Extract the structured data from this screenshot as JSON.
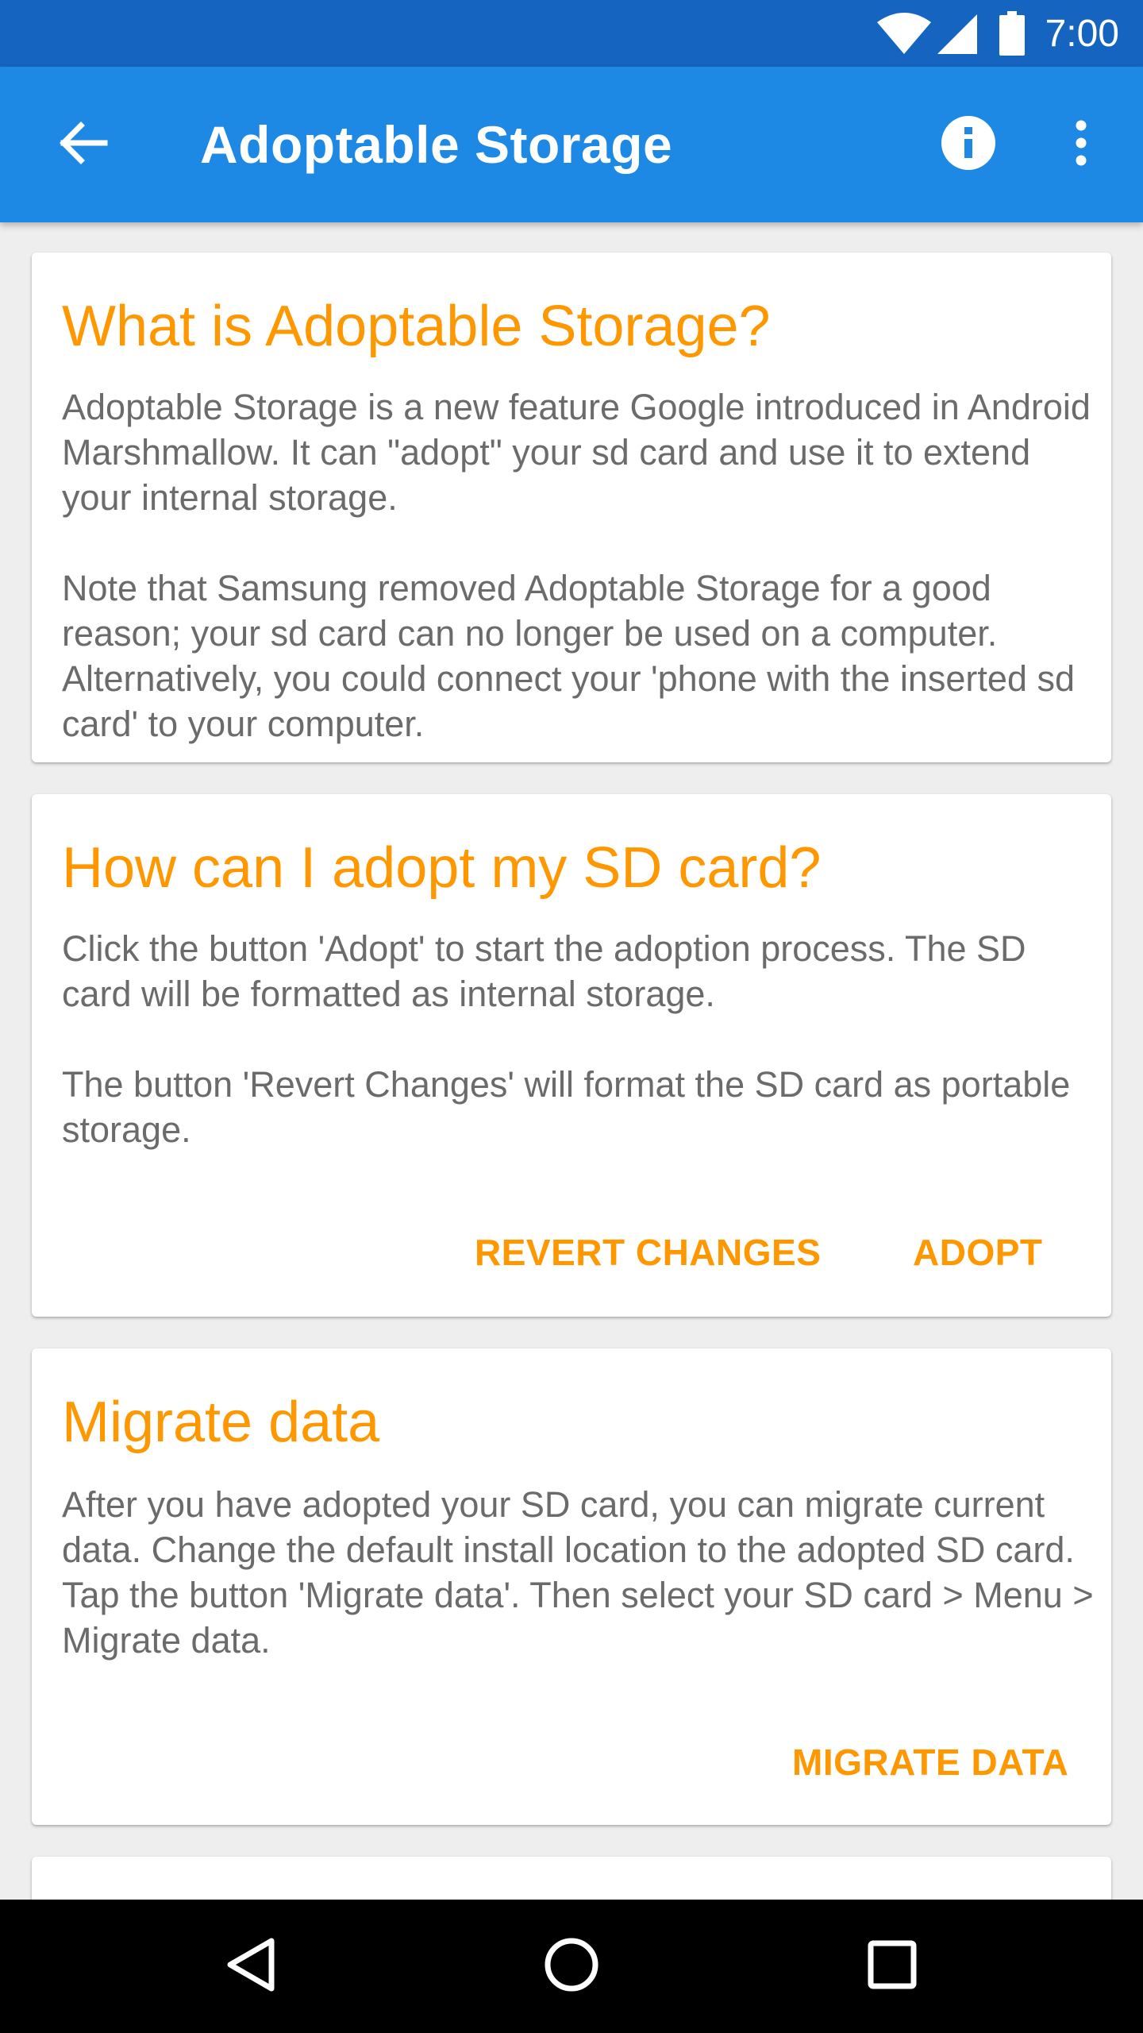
{
  "status_bar": {
    "time": "7:00",
    "icons": [
      "wifi-icon",
      "signal-icon",
      "battery-icon"
    ]
  },
  "app_bar": {
    "title": "Adoptable Storage",
    "back_icon": "arrow-back-icon",
    "info_icon": "info-icon",
    "more_icon": "more-vert-icon"
  },
  "cards": [
    {
      "title": "What is Adoptable Storage?",
      "paragraphs": [
        "Adoptable Storage is a new feature Google introduced in Android Marshmallow. It can \"adopt\" your sd card and use it to extend your internal storage.",
        "Note that Samsung removed Adoptable Storage for a good reason; your sd card can no longer be used on a computer. Alternatively, you could connect your 'phone with the inserted sd card' to your computer."
      ]
    },
    {
      "title": "How can I adopt my SD card?",
      "paragraphs": [
        "Click the button 'Adopt' to start the adoption process. The SD card will be formatted as internal storage.",
        "The button 'Revert Changes' will format the SD card as portable storage."
      ],
      "actions": {
        "revert": "REVERT CHANGES",
        "adopt": "ADOPT"
      }
    },
    {
      "title": "Migrate data",
      "paragraphs": [
        "After you have adopted your SD card, you can migrate current data. Change the default install location to the adopted SD card. Tap the button 'Migrate data'. Then select your SD card > Menu > Migrate data."
      ],
      "actions": {
        "migrate": "MIGRATE DATA"
      }
    }
  ],
  "nav_bar": {
    "icons": [
      "back-triangle-icon",
      "home-circle-icon",
      "recents-square-icon"
    ]
  },
  "colors": {
    "status_bar": "#1565c0",
    "app_bar": "#1e88e5",
    "accent": "#ff9800",
    "body_text": "#6b6b6b",
    "background": "#eeeeee"
  }
}
